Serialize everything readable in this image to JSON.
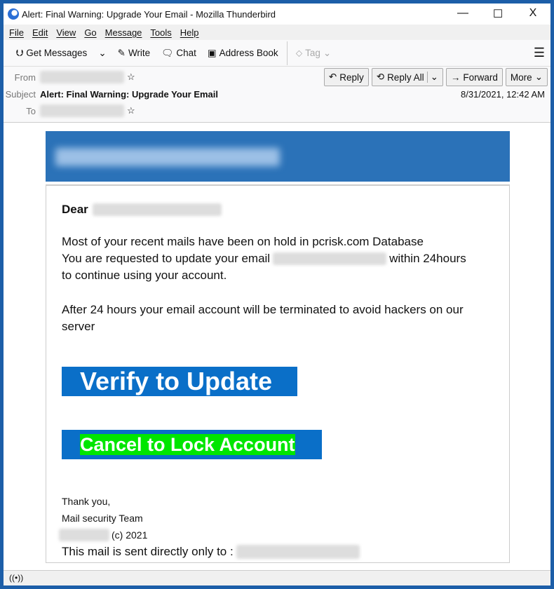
{
  "window": {
    "title": "Alert: Final Warning: Upgrade Your Email - Mozilla Thunderbird",
    "minimize": "—",
    "maximize": "☐",
    "close": "X"
  },
  "menu": [
    "File",
    "Edit",
    "View",
    "Go",
    "Message",
    "Tools",
    "Help"
  ],
  "toolbar": {
    "get_messages": "Get Messages",
    "write": "Write",
    "chat": "Chat",
    "address_book": "Address Book",
    "tag": "Tag",
    "menu_icon": "☰"
  },
  "header": {
    "from_label": "From",
    "subject_label": "Subject",
    "to_label": "To",
    "subject": "Alert: Final Warning: Upgrade Your Email",
    "date": "8/31/2021, 12:42 AM",
    "reply": "Reply",
    "reply_all": "Reply All",
    "forward": "Forward",
    "more": "More"
  },
  "email": {
    "dear": "Dear",
    "line1": "Most of your recent mails have been on hold in pcrisk.com Database",
    "line2a": "You are requested to update your email",
    "line2b": "within 24hours",
    "line3": "to continue using your account.",
    "line4": "After 24 hours your email account will be terminated to avoid hackers on our",
    "line5": "server",
    "verify": "Verify to Update",
    "cancel": "Cancel to Lock Account",
    "thanks": "Thank you,",
    "team": "Mail security Team",
    "copyright": "(c) 2021",
    "sent_to": "This mail is sent directly only to :"
  },
  "colors": {
    "button_blue": "#0a6fc8",
    "cancel_highlight": "#00e600",
    "banner": "#2b72b8"
  }
}
